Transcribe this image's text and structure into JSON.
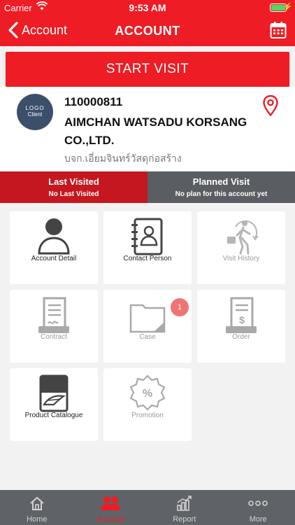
{
  "status_bar": {
    "carrier": "Carrier",
    "time": "9:53 AM",
    "battery_level": 1.0
  },
  "nav": {
    "back_label": "Account",
    "title": "ACCOUNT"
  },
  "start_visit_label": "START VISIT",
  "account": {
    "logo_line1": "LOGO",
    "logo_line2": "Client",
    "code": "110000811",
    "name": "AIMCHAN WATSADU KORSANG CO.,LTD.",
    "thai_name": "บจก.เอี่ยมจินทร์วัสดุก่อสร้าง"
  },
  "last_visited": {
    "heading": "Last Visited",
    "subtext": "No Last Visited"
  },
  "planned_visit": {
    "heading": "Planned Visit",
    "subtext": "No plan for this account yet"
  },
  "tiles": {
    "account_detail": "Account Detail",
    "contact_person": "Contact Person",
    "visit_history": "Visit History",
    "contract": "Contract",
    "case": "Case",
    "case_badge": "1",
    "order": "Order",
    "product_catalogue": "Product Catalogue",
    "promotion": "Promotion"
  },
  "tabbar": {
    "home": "Home",
    "account": "Account",
    "report": "Report",
    "more": "More"
  },
  "colors": {
    "brand_red": "#ee1c25",
    "dark_red": "#c5171f",
    "gray_bar": "#5a5d61",
    "tab_bg": "#5f6368"
  }
}
